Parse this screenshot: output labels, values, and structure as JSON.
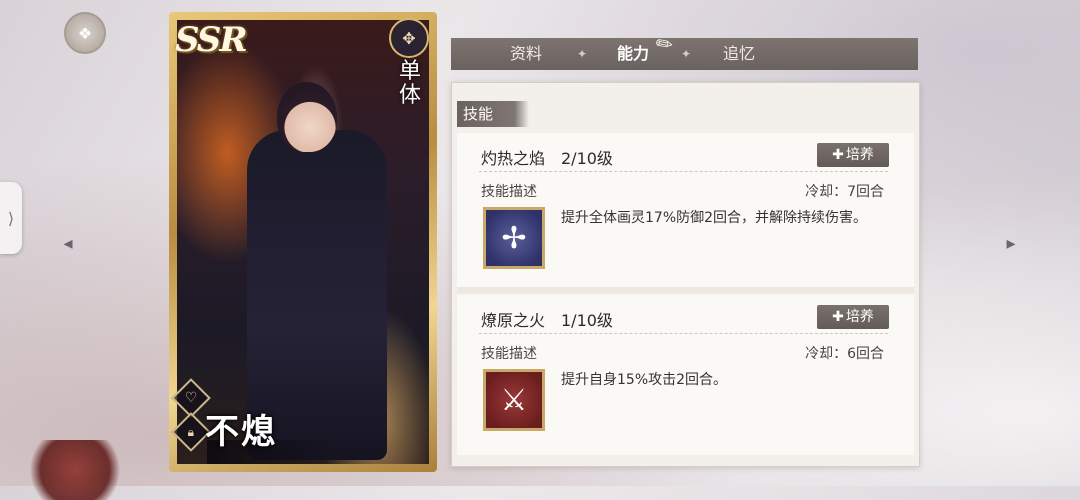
{
  "card": {
    "rarity": "SSR",
    "target_type": "单体",
    "name": "不熄",
    "icons": {
      "type": "ornament-icon",
      "favorite": "heart-icon",
      "lock": "lock-icon"
    }
  },
  "tabs": [
    {
      "label": "资料",
      "active": false
    },
    {
      "label": "能力",
      "active": true
    },
    {
      "label": "追忆",
      "active": false
    }
  ],
  "section": {
    "title": "技能"
  },
  "skills": [
    {
      "name": "灼热之焰",
      "level": "2/10级",
      "train_label": "培养",
      "desc_label": "技能描述",
      "cooldown": "冷却：7回合",
      "description": "提升全体画灵17%防御2回合，并解除持续伤害。",
      "icon": "winged-cross-icon"
    },
    {
      "name": "燎原之火",
      "level": "1/10级",
      "train_label": "培养",
      "desc_label": "技能描述",
      "cooldown": "冷却：6回合",
      "description": "提升自身15%攻击2回合。",
      "icon": "crossed-swords-icon"
    }
  ],
  "colors": {
    "tab_bar": "#6a625f",
    "panel_bg": "#f3efea",
    "card_frame": "#d8b86c"
  }
}
